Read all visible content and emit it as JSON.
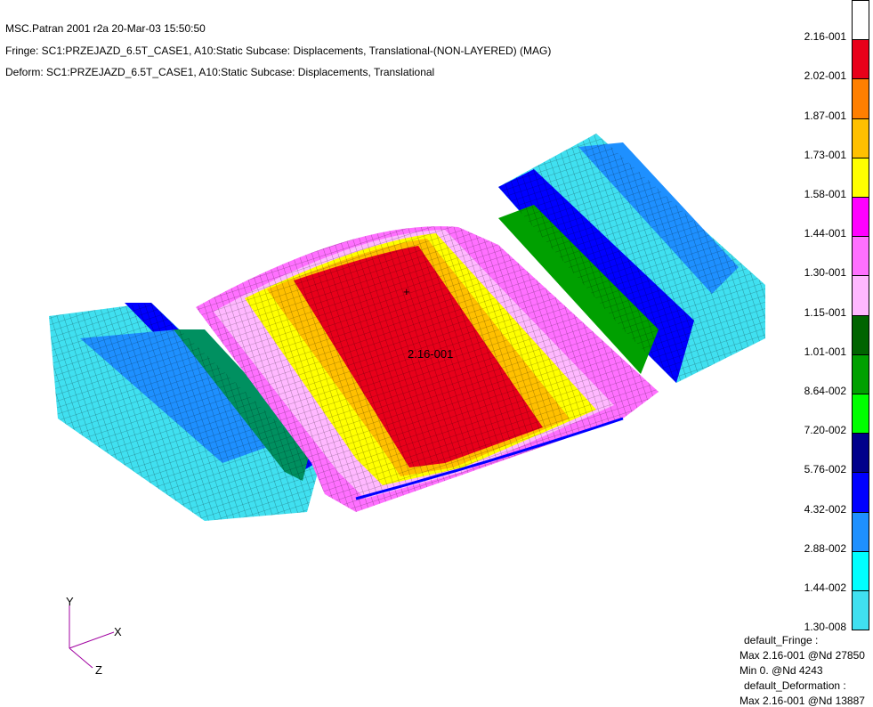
{
  "header": {
    "line1": "MSC.Patran 2001 r2a 20-Mar-03 15:50:50",
    "line2": "Fringe: SC1:PRZEJAZD_6.5T_CASE1, A10:Static Subcase: Displacements, Translational-(NON-LAYERED) (MAG)",
    "line3": "Deform: SC1:PRZEJAZD_6.5T_CASE1, A10:Static Subcase: Displacements, Translational"
  },
  "legend": {
    "colors": [
      "#ffffff",
      "#e8001a",
      "#ff7f00",
      "#ffc000",
      "#ffff00",
      "#ff00ff",
      "#ff70ff",
      "#ffb8ff",
      "#006400",
      "#00a000",
      "#00ff00",
      "#00008b",
      "#0000ff",
      "#1e90ff",
      "#00ffff",
      "#40e0f0"
    ],
    "ticks": [
      "2.16-001",
      "2.02-001",
      "1.87-001",
      "1.73-001",
      "1.58-001",
      "1.44-001",
      "1.30-001",
      "1.15-001",
      "1.01-001",
      "8.64-002",
      "7.20-002",
      "5.76-002",
      "4.32-002",
      "2.88-002",
      "1.44-002",
      "1.30-008"
    ]
  },
  "info": {
    "fringe_title": "default_Fringe :",
    "fringe_max": "Max 2.16-001 @Nd 27850",
    "fringe_min": "Min  0. @Nd 4243",
    "deform_title": "default_Deformation :",
    "deform_max": "Max 2.16-001 @Nd 13887"
  },
  "triad": {
    "x": "X",
    "y": "Y",
    "z": "Z"
  },
  "max_marker": {
    "label": "2.16-001",
    "symbol": "+"
  }
}
